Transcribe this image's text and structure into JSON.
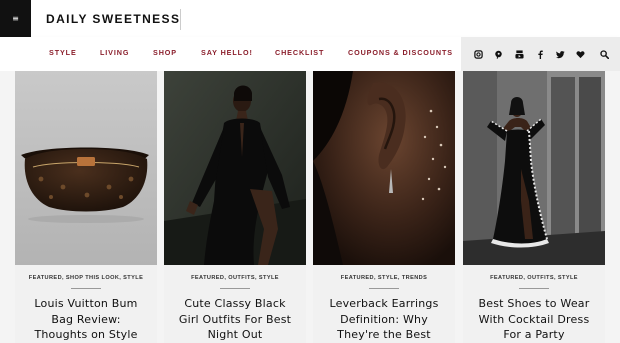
{
  "header": {
    "menu_glyph": "≡",
    "site_title": "DAILY SWEETNESS"
  },
  "nav": {
    "items": [
      "STYLE",
      "LIVING",
      "SHOP",
      "SAY HELLO!",
      "CHECKLIST",
      "COUPONS & DISCOUNTS"
    ],
    "color": "#8b1f2c"
  },
  "social": {
    "icons": [
      "instagram-icon",
      "pinterest-icon",
      "youtube-icon",
      "facebook-icon",
      "twitter-icon",
      "heart-icon",
      "search-icon"
    ]
  },
  "posts": [
    {
      "tags": "FEATURED, SHOP THIS LOOK, STYLE",
      "title": "Louis Vuitton Bum Bag Review: Thoughts on Style"
    },
    {
      "tags": "FEATURED, OUTFITS, STYLE",
      "title": "Cute Classy Black Girl Outfits For Best Night Out"
    },
    {
      "tags": "FEATURED, STYLE, TRENDS",
      "title": "Leverback Earrings Definition: Why They're the Best"
    },
    {
      "tags": "FEATURED, OUTFITS, STYLE",
      "title": "Best Shoes to Wear With Cocktail Dress For a Party"
    }
  ]
}
